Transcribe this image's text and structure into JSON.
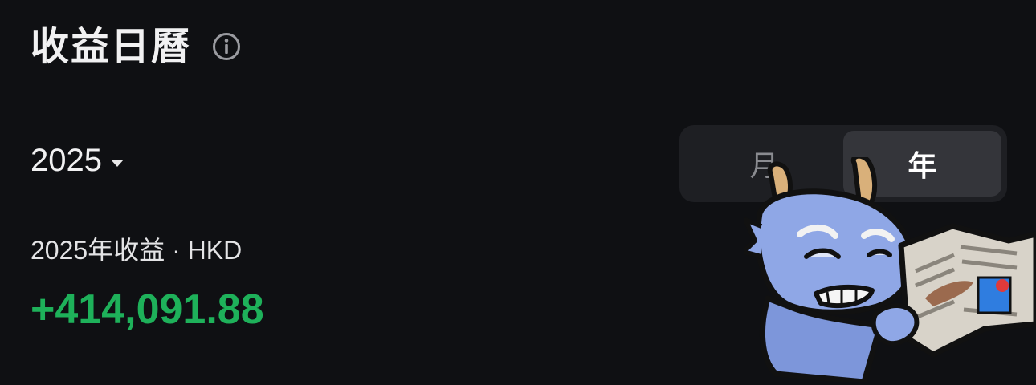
{
  "header": {
    "title": "收益日曆",
    "info_icon": "info-circle-icon"
  },
  "year_selector": {
    "value": "2025",
    "caret_icon": "caret-down-icon"
  },
  "period_toggle": {
    "options": [
      {
        "label": "月",
        "selected": false
      },
      {
        "label": "年",
        "selected": true
      }
    ]
  },
  "summary": {
    "label": "2025年收益",
    "separator": " · ",
    "currency": "HKD",
    "amount": "+414,091.88",
    "amount_color": "#1eb15a"
  },
  "sticker": {
    "icon": "dragon-reading-newspaper-sticker"
  },
  "colors": {
    "background": "#0f1013",
    "toggle_bg": "#1e1f23",
    "toggle_selected_bg": "#34353a",
    "positive": "#1eb15a"
  }
}
